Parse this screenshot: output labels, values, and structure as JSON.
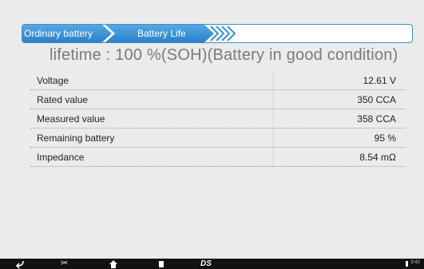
{
  "breadcrumb": {
    "items": [
      "Ordinary battery",
      "Battery Life"
    ]
  },
  "headline": "lifetime :  100  %(SOH)(Battery in good condition)",
  "table": {
    "rows": [
      {
        "label": "Voltage",
        "value": "12.61 V"
      },
      {
        "label": "Rated value",
        "value": "350 CCA"
      },
      {
        "label": "Measured value",
        "value": "358 CCA"
      },
      {
        "label": "Remaining battery",
        "value": "95 %"
      },
      {
        "label": "Impedance",
        "value": "8.54 mΩ"
      }
    ]
  },
  "navbar": {
    "icons": [
      "back-icon",
      "scissors-icon",
      "home-icon",
      "recents-icon",
      "ds-logo-icon"
    ],
    "logo_text": "DS",
    "clock": "3:42"
  },
  "colors": {
    "accent": "#3a8fd0",
    "crumb_top": "#56a8e3",
    "crumb_bottom": "#2b7fc7"
  }
}
